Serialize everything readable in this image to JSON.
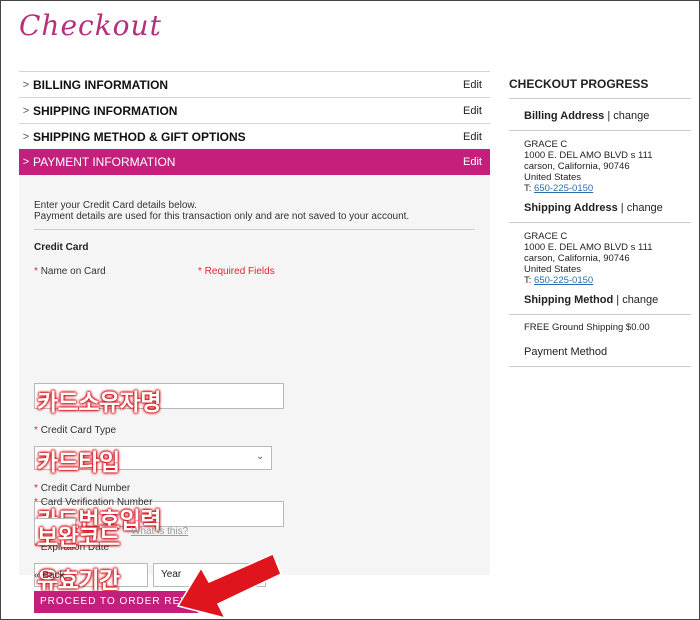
{
  "page_title": "Checkout",
  "sections": [
    {
      "label": "BILLING INFORMATION",
      "edit": "Edit"
    },
    {
      "label": "SHIPPING INFORMATION",
      "edit": "Edit"
    },
    {
      "label": "SHIPPING METHOD & GIFT OPTIONS",
      "edit": "Edit"
    },
    {
      "label": "PAYMENT INFORMATION",
      "edit": "Edit"
    }
  ],
  "payment": {
    "intro_line1": "Enter your Credit Card details below.",
    "intro_line2": "Payment details are used for this transaction only and are not saved to your account.",
    "heading": "Credit Card",
    "required_note": "* Required Fields",
    "star": "*",
    "name_label": "Name on Card",
    "name_overlay": "카드소유자명",
    "type_label": "Credit Card Type",
    "type_overlay": "카드타입",
    "number_label": "Credit Card Number",
    "number_overlay": "카드번호입력",
    "exp_label": "Expiration Date",
    "exp_overlay": "유효기간",
    "year_value": "Year",
    "cvn_label": "Card Verification Number",
    "cvn_overlay": "보완코드",
    "what_is_this": "What is this?",
    "back": "« Back",
    "proceed": "PROCEED TO ORDER REVIEW"
  },
  "progress": {
    "title": "CHECKOUT PROGRESS",
    "billing_head": "Billing Address",
    "change": "change",
    "billing": {
      "name": "GRACE C",
      "line1": "1000 E. DEL AMO BLVD s 111",
      "line2": "carson, California, 90746",
      "country": "United States",
      "phone_prefix": "T:",
      "phone": "650-225-0150"
    },
    "shipping_head": "Shipping Address",
    "shipping": {
      "name": "GRACE C",
      "line1": "1000 E. DEL AMO BLVD s 111",
      "line2": "carson, California, 90746",
      "country": "United States",
      "phone_prefix": "T:",
      "phone": "650-225-0150"
    },
    "method_head": "Shipping Method",
    "method_value": "FREE Ground Shipping $0.00",
    "payment_method": "Payment Method"
  },
  "colors": {
    "accent": "#c41f7d",
    "overlay_red": "#d4141f",
    "required_red": "#e0282e",
    "link": "#2a6cb0"
  }
}
